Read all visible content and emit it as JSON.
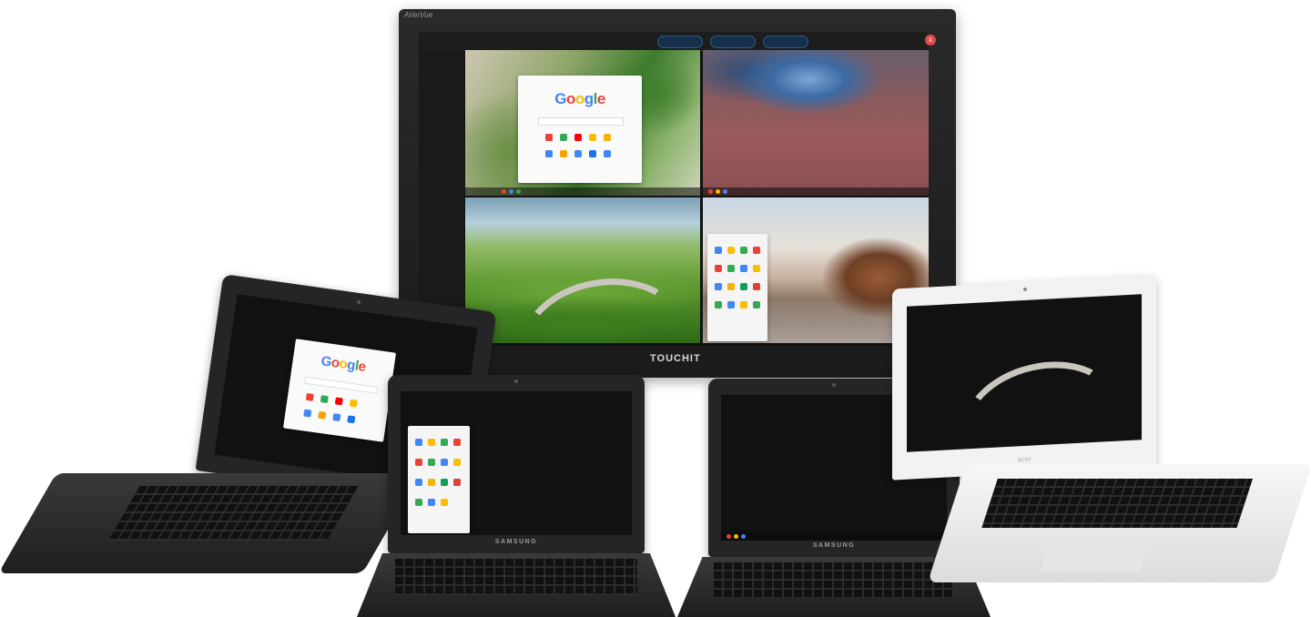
{
  "display": {
    "brand_top_left": "AVerVue",
    "brand_bottom": "TOUCHIT",
    "close_symbol": "x",
    "google_logo": [
      "G",
      "o",
      "o",
      "g",
      "l",
      "e"
    ]
  },
  "laptops": {
    "hp": {
      "google_logo": [
        "G",
        "o",
        "o",
        "g",
        "l",
        "e"
      ]
    },
    "samsung_left": {
      "bezel_brand": "SAMSUNG"
    },
    "samsung_right": {
      "bezel_brand": "SAMSUNG"
    },
    "acer": {
      "lid_brand": "acer"
    }
  },
  "colors": {
    "google_blue": "#4285f4",
    "google_red": "#ea4335",
    "google_yellow": "#fbbc05",
    "google_green": "#34a853"
  }
}
